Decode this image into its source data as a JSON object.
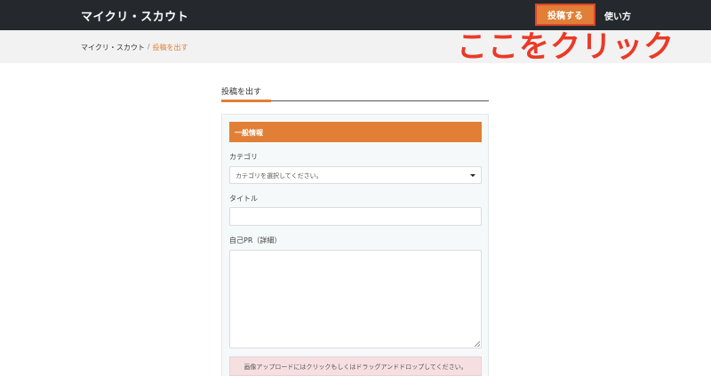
{
  "header": {
    "brand": "マイクリ・スカウト",
    "post_button": "投稿する",
    "howto": "使い方"
  },
  "breadcrumb": {
    "home": "マイクリ・スカウト",
    "separator": "/",
    "current": "投稿を出す"
  },
  "annotation": "ここをクリック",
  "page": {
    "tab_title": "投稿を出す"
  },
  "form": {
    "section_title": "一般情報",
    "category_label": "カテゴリ",
    "category_value": "カテゴリを選択してください。",
    "title_label": "タイトル",
    "title_value": "",
    "pr_label": "自己PR（詳細）",
    "pr_value": "",
    "upload_text": "画像アップロードにはクリックもしくはドラッグアンドドロップしてください。"
  },
  "colors": {
    "navbar": "#25292e",
    "accent": "#e07f35",
    "annotation": "#ea3a27",
    "dropzone": "#f6dfe1"
  }
}
